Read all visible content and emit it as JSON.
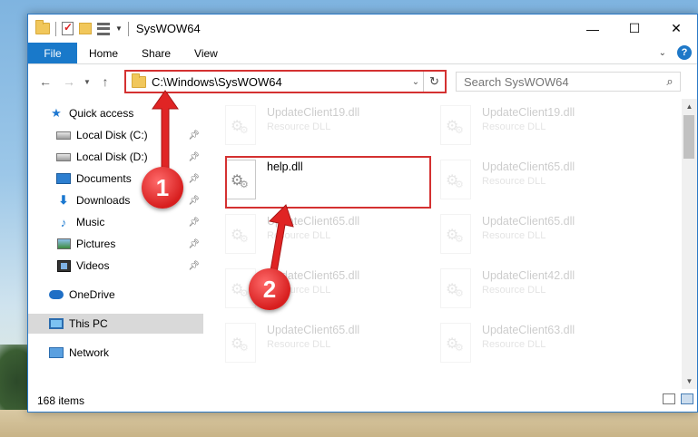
{
  "window": {
    "title": "SysWOW64",
    "controls": {
      "minimize": "—",
      "maximize": "☐",
      "close": "✕"
    }
  },
  "ribbon": {
    "tabs": [
      "File",
      "Home",
      "Share",
      "View"
    ]
  },
  "address": {
    "path": "C:\\Windows\\SysWOW64",
    "search_placeholder": "Search SysWOW64"
  },
  "navpane": {
    "items": [
      {
        "label": "Quick access",
        "icon": "star-icon",
        "pinned": false
      },
      {
        "label": "Local Disk (C:)",
        "icon": "disk-icon",
        "pinned": true
      },
      {
        "label": "Local Disk (D:)",
        "icon": "disk-icon",
        "pinned": true
      },
      {
        "label": "Documents",
        "icon": "documents-icon",
        "pinned": true
      },
      {
        "label": "Downloads",
        "icon": "downloads-icon",
        "pinned": true
      },
      {
        "label": "Music",
        "icon": "music-icon",
        "pinned": true
      },
      {
        "label": "Pictures",
        "icon": "pictures-icon",
        "pinned": true
      },
      {
        "label": "Videos",
        "icon": "videos-icon",
        "pinned": true
      },
      {
        "label": "OneDrive",
        "icon": "onedrive-icon",
        "pinned": false
      },
      {
        "label": "This PC",
        "icon": "this-pc-icon",
        "pinned": false,
        "selected": true
      },
      {
        "label": "Network",
        "icon": "network-icon",
        "pinned": false
      }
    ]
  },
  "files": [
    {
      "name": "UpdateClient19.dll",
      "type": "Resource DLL",
      "faded": true
    },
    {
      "name": "UpdateClient19.dll",
      "type": "Resource DLL",
      "faded": true
    },
    {
      "name": "help.dll",
      "type": "",
      "faded": false
    },
    {
      "name": "UpdateClient65.dll",
      "type": "Resource DLL",
      "faded": true
    },
    {
      "name": "UpdateClient65.dll",
      "type": "Resource DLL",
      "faded": true
    },
    {
      "name": "UpdateClient65.dll",
      "type": "Resource DLL",
      "faded": true
    },
    {
      "name": "UpdateClient65.dll",
      "type": "Resource DLL",
      "faded": true
    },
    {
      "name": "UpdateClient42.dll",
      "type": "Resource DLL",
      "faded": true
    },
    {
      "name": "UpdateClient65.dll",
      "type": "Resource DLL",
      "faded": true
    },
    {
      "name": "UpdateClient63.dll",
      "type": "Resource DLL",
      "faded": true
    }
  ],
  "status": {
    "item_count": "168 items"
  },
  "annotations": {
    "step1": "1",
    "step2": "2",
    "highlight_color": "#d43131"
  }
}
